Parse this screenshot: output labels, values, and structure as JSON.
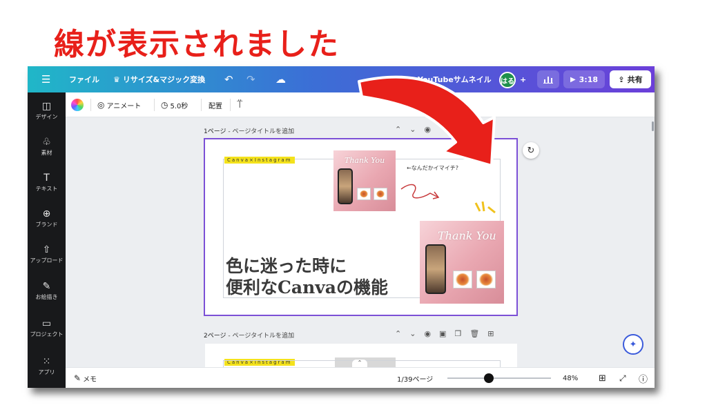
{
  "headline": "線が表示されました",
  "topbar": {
    "menu_icon": "menu-icon",
    "file_label": "ファイル",
    "resize_label": "リサイズ&マジック変換",
    "resize_icon": "♛",
    "undo_icon": "undo-icon",
    "redo_icon": "redo-icon",
    "cloud_icon": "cloud-check-icon",
    "doc_title": "YouTubeサムネイル",
    "avatar_text": "はる",
    "add_icon": "+",
    "analytics_icon": "bar-chart-icon",
    "play_time": "3:18",
    "share_label": "共有"
  },
  "sidebar": {
    "items": [
      {
        "label": "デザイン",
        "icon": "design-icon"
      },
      {
        "label": "素材",
        "icon": "elements-icon"
      },
      {
        "label": "テキスト",
        "icon": "text-icon"
      },
      {
        "label": "ブランド",
        "icon": "brand-icon"
      },
      {
        "label": "アップロード",
        "icon": "upload-icon"
      },
      {
        "label": "お絵描き",
        "icon": "draw-icon"
      },
      {
        "label": "プロジェクト",
        "icon": "folder-icon"
      },
      {
        "label": "アプリ",
        "icon": "apps-icon"
      }
    ]
  },
  "toolbar": {
    "animate_label": "アニメート",
    "duration_label": "5.0秒",
    "position_label": "配置",
    "paint_icon": "paint-roller-icon"
  },
  "pages": [
    {
      "number_label": "1ページ",
      "title_placeholder": "ページタイトルを追加"
    },
    {
      "number_label": "2ページ",
      "title_placeholder": "ページタイトルを追加"
    }
  ],
  "canvas": {
    "tagline": "Canva×Instagram",
    "thumb_title": "Thank You",
    "note_text": "←なんだかイマイチ?",
    "main_text_line1": "色に迷った時に",
    "main_text_line2": "便利なCanvaの機能"
  },
  "bottombar": {
    "notes_label": "メモ",
    "page_counter": "1/39ページ",
    "zoom_level": "48%",
    "zoom_fraction": 0.4
  },
  "colors": {
    "headline": "#e8201a",
    "selection": "#7b4fd6",
    "arrow": "#e8201a",
    "tagline_bg": "#f4e21c"
  }
}
